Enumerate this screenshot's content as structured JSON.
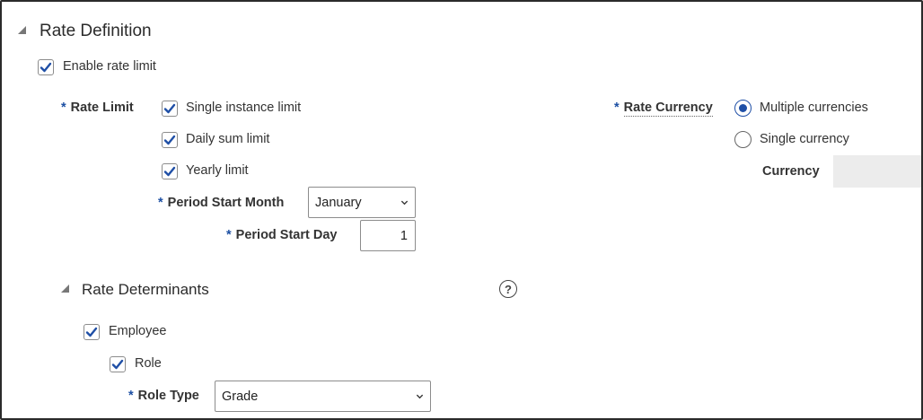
{
  "rate_definition": {
    "title": "Rate Definition",
    "enable_rate_limit": {
      "label": "Enable rate limit",
      "checked": true
    },
    "rate_limit": {
      "label": "Rate Limit",
      "options": [
        {
          "label": "Single instance limit",
          "checked": true
        },
        {
          "label": "Daily sum limit",
          "checked": true
        },
        {
          "label": "Yearly limit",
          "checked": true
        }
      ]
    },
    "period_start_month": {
      "label": "Period Start Month",
      "value": "January"
    },
    "period_start_day": {
      "label": "Period Start Day",
      "value": "1"
    },
    "rate_currency": {
      "label": "Rate Currency",
      "options": [
        {
          "label": "Multiple currencies",
          "selected": true
        },
        {
          "label": "Single currency",
          "selected": false
        }
      ]
    },
    "currency": {
      "label": "Currency",
      "value": ""
    }
  },
  "rate_determinants": {
    "title": "Rate Determinants",
    "help_icon": "question-circle-icon",
    "employee": {
      "label": "Employee",
      "checked": true
    },
    "role": {
      "label": "Role",
      "checked": true
    },
    "role_type": {
      "label": "Role Type",
      "value": "Grade"
    }
  },
  "required_marker": "*",
  "colors": {
    "accent": "#1f4fa6",
    "required": "#1c4fa3",
    "text": "#333333"
  }
}
